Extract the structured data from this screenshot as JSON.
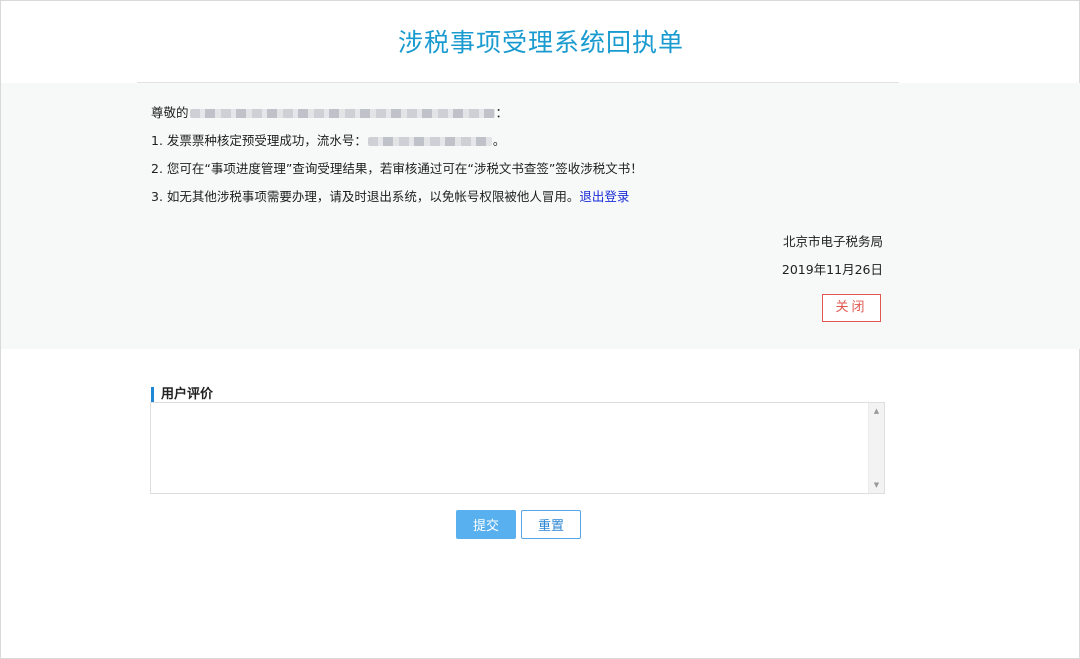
{
  "header": {
    "title": "涉税事项受理系统回执单"
  },
  "receipt": {
    "greeting_prefix": "尊敬的",
    "greeting_suffix": "：",
    "line1_prefix": "1. 发票票种核定预受理成功，流水号：",
    "line1_suffix": "。",
    "line2": "2. 您可在“事项进度管理”查询受理结果，若审核通过可在“涉税文书查签”签收涉税文书！",
    "line3_text": "3. 如无其他涉税事项需要办理，请及时退出系统，以免帐号权限被他人冒用。",
    "logout_link": "退出登录",
    "issuer": "北京市电子税务局",
    "date": "2019年11月26日",
    "close_button": "关闭"
  },
  "feedback": {
    "section_title": "用户评价",
    "comment_value": "",
    "submit_button": "提交",
    "reset_button": "重置"
  },
  "colors": {
    "title": "#1a9bd0",
    "link": "#1a2dd6",
    "close_border": "#e0574f",
    "submit_bg": "#58b0ef",
    "section_accent": "#1e88d6",
    "panel_bg": "#f7f9f9"
  },
  "icons": {
    "scroll_up": "triangle-up",
    "scroll_down": "triangle-down"
  }
}
